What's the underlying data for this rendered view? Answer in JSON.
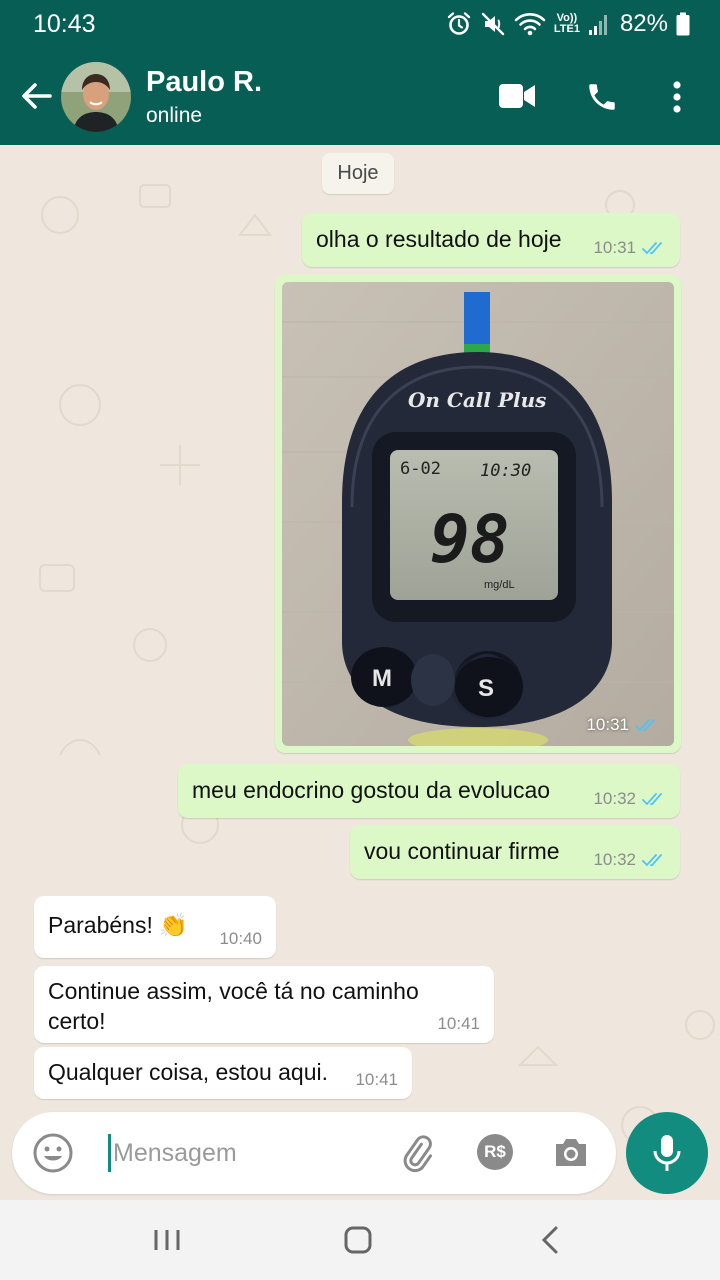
{
  "status_bar": {
    "time": "10:43",
    "battery": "82%",
    "volte": "Vo))\nLTE1",
    "icons": [
      "alarm-icon",
      "mute-icon",
      "wifi-icon",
      "volte-icon",
      "signal-icon",
      "battery-icon"
    ]
  },
  "header": {
    "name": "Paulo R.",
    "status": "online",
    "icons": [
      "back-arrow-icon",
      "video-call-icon",
      "phone-icon",
      "more-vert-icon"
    ]
  },
  "chat": {
    "date_chip": "Hoje",
    "messages": [
      {
        "dir": "out",
        "text": "olha o resultado de hoje",
        "time": "10:31",
        "read": true
      },
      {
        "dir": "out",
        "type": "image",
        "time": "10:31",
        "read": true,
        "image": {
          "brand": "On Call Plus",
          "date": "6-02",
          "clock": "10:30",
          "reading": "98",
          "unit": "mg/dL",
          "button_left": "M",
          "button_right": "S"
        }
      },
      {
        "dir": "out",
        "text": "meu endocrino gostou da evolucao",
        "time": "10:32",
        "read": true
      },
      {
        "dir": "out",
        "text": "vou continuar firme",
        "time": "10:32",
        "read": true
      },
      {
        "dir": "in",
        "text": "Parabéns! 👏",
        "time": "10:40"
      },
      {
        "dir": "in",
        "text_line1": "Continue assim, você tá no caminho",
        "text_line2": "certo!",
        "time": "10:41"
      },
      {
        "dir": "in",
        "text": "Qualquer coisa, estou aqui.",
        "time": "10:41"
      }
    ]
  },
  "input": {
    "placeholder": "Mensagem",
    "value": "",
    "icons": [
      "emoji-icon",
      "attach-icon",
      "payment-icon",
      "camera-icon",
      "mic-icon"
    ],
    "payment_label": "R$"
  },
  "colors": {
    "header": "#075e54",
    "outgoing_bubble": "#dcf8c6",
    "incoming_bubble": "#ffffff",
    "accent": "#128c7e",
    "read_ticks": "#4fc3f7"
  }
}
